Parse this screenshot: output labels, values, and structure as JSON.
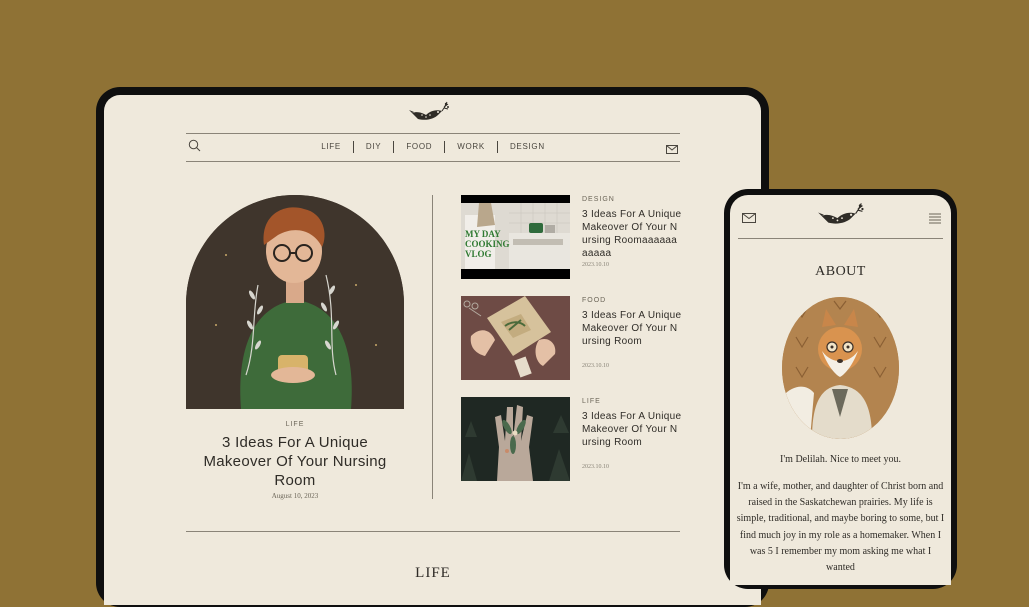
{
  "tablet": {
    "nav": {
      "items": [
        {
          "label": "LIFE"
        },
        {
          "label": "DIY"
        },
        {
          "label": "FOOD"
        },
        {
          "label": "WORK"
        },
        {
          "label": "DESIGN"
        }
      ]
    },
    "featured": {
      "category": "LIFE",
      "title": "3 Ideas For A Unique Makeover Of Your Nursing Room",
      "date": "August 10, 2023"
    },
    "posts": [
      {
        "category": "DESIGN",
        "title": "3 Ideas For A Unique Makeover Of Your Nursing Roomaaaaaaaaaaa",
        "date": "2023.10.10",
        "thumb_text": "MY DAY COOKING VLOG"
      },
      {
        "category": "FOOD",
        "title": "3 Ideas For A Unique Makeover Of Your Nursing Room",
        "date": "2023.10.10"
      },
      {
        "category": "LIFE",
        "title": "3 Ideas For A Unique Makeover Of Your Nursing Room",
        "date": "2023.10.10"
      }
    ],
    "section_title": "LIFE"
  },
  "phone": {
    "about_title": "ABOUT",
    "greeting": "I'm Delilah. Nice to meet you.",
    "bio": "I'm a wife, mother, and daughter of Christ born and raised in the Saskatchewan prairies. My life is simple, traditional, and maybe boring to some, but I find much joy in my role as a homemaker. When I was 5 I remember my mom asking me what I wanted"
  },
  "colors": {
    "background": "#8f7235",
    "paper": "#efe9dc",
    "ink": "#2f2c27",
    "device_frame": "#0f0f0f"
  },
  "icons": [
    "search-icon",
    "mail-icon",
    "menu-icon",
    "bird-logo-icon"
  ]
}
